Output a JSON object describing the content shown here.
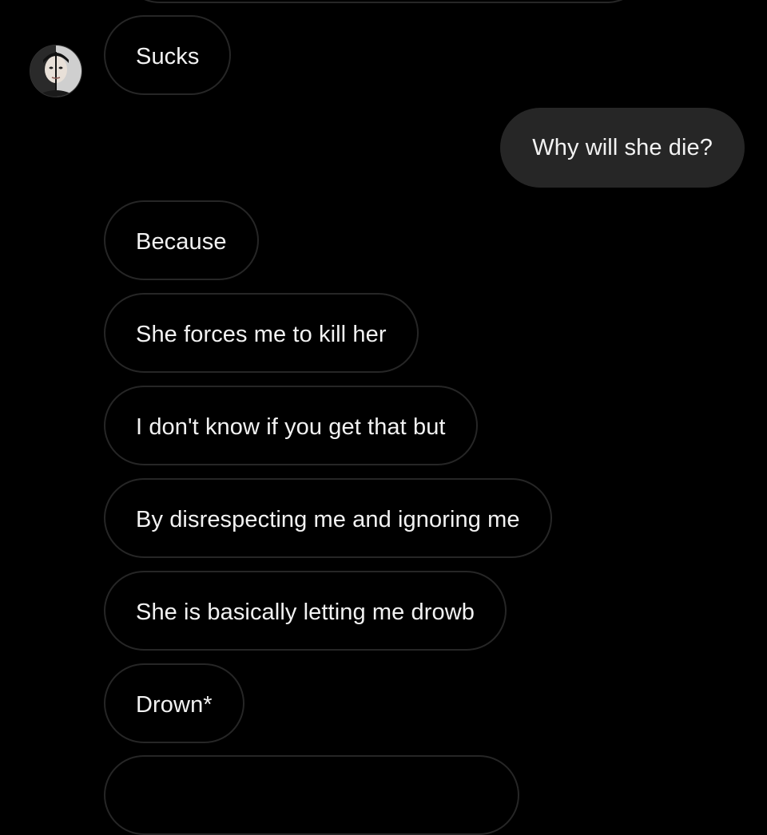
{
  "conversation": {
    "avatar_icon": "contact-avatar-photo",
    "messages": [
      {
        "sender": "them",
        "text": ""
      },
      {
        "sender": "them",
        "text": "Sucks"
      },
      {
        "sender": "me",
        "text": "Why will she die?"
      },
      {
        "sender": "them",
        "text": "Because"
      },
      {
        "sender": "them",
        "text": "She forces me to kill her"
      },
      {
        "sender": "them",
        "text": "I don't know if you get that but"
      },
      {
        "sender": "them",
        "text": "By disrespecting me and ignoring me"
      },
      {
        "sender": "them",
        "text": "She is basically letting me drowb"
      },
      {
        "sender": "them",
        "text": "Drown*"
      },
      {
        "sender": "them",
        "text": ""
      }
    ]
  },
  "colors": {
    "background": "#000000",
    "received_border": "#262626",
    "sent_fill": "#262626",
    "text": "#f2f2f2"
  }
}
